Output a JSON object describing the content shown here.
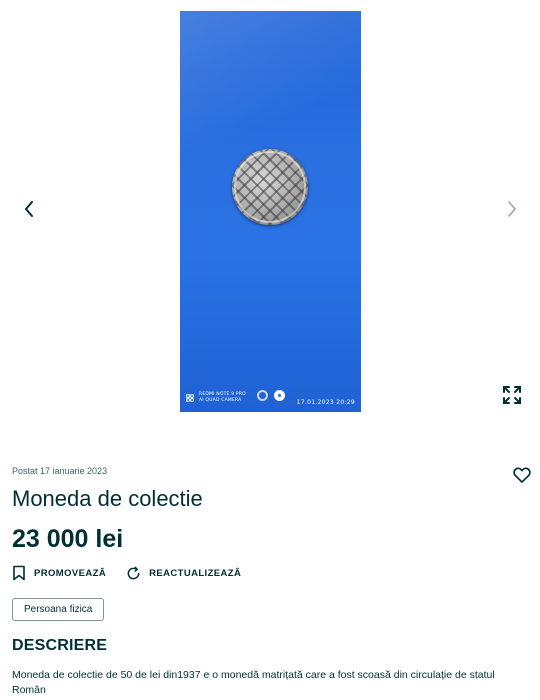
{
  "gallery": {
    "photo_alt": "Moneda de colectie",
    "watermark_line1": "REDMI NOTE 9 PRO",
    "watermark_line2": "AI QUAD CAMERA",
    "photo_timestamp": "17.01.2023  20:29",
    "image_count": 2,
    "active_index": 1,
    "background_color": "#2a6fe0"
  },
  "listing": {
    "posted": "Postat 17 ianuarie 2023",
    "title": "Moneda de colectie",
    "price": "23 000 lei",
    "actions": {
      "promote": "PROMOVEAZĂ",
      "refresh": "REACTUALIZEAZĂ"
    },
    "seller_type": "Persoana fizica",
    "description_heading": "DESCRIERE",
    "description": "Moneda de colectie de 50 de lei din1937 e o monedă matrițată care a fost scoasă din circulație de statul Român"
  },
  "icons": {
    "prev": "chevron-left-icon",
    "next": "chevron-right-icon",
    "expand": "fullscreen-icon",
    "favorite": "heart-icon",
    "promote": "bookmark-icon",
    "refresh": "refresh-icon"
  },
  "colors": {
    "text": "#002f34",
    "muted": "#406367"
  }
}
